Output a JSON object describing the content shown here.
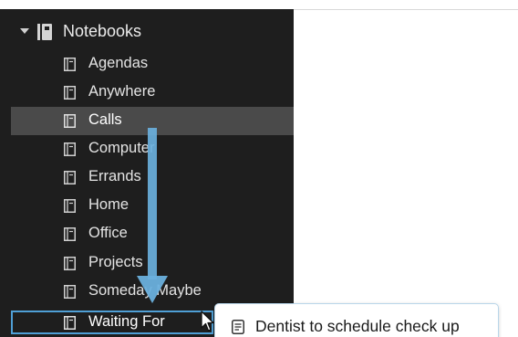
{
  "sidebar": {
    "section": {
      "label": "Notebooks",
      "expanded": true,
      "icon": "notebook-stack-icon"
    },
    "items": [
      {
        "label": "Agendas",
        "icon": "notebook-icon",
        "state": "normal"
      },
      {
        "label": "Anywhere",
        "icon": "notebook-icon",
        "state": "normal"
      },
      {
        "label": "Calls",
        "icon": "notebook-icon",
        "state": "selected"
      },
      {
        "label": "Computer",
        "icon": "notebook-icon",
        "state": "normal"
      },
      {
        "label": "Errands",
        "icon": "notebook-icon",
        "state": "normal"
      },
      {
        "label": "Home",
        "icon": "notebook-icon",
        "state": "normal"
      },
      {
        "label": "Office",
        "icon": "notebook-icon",
        "state": "normal"
      },
      {
        "label": "Projects",
        "icon": "notebook-icon",
        "state": "normal"
      },
      {
        "label": "Someday Maybe",
        "icon": "notebook-icon",
        "state": "normal"
      },
      {
        "label": "Waiting For",
        "icon": "notebook-icon",
        "state": "drop-target"
      }
    ]
  },
  "drag": {
    "note_title": "Dentist to schedule check up",
    "icon": "note-icon"
  },
  "colors": {
    "sidebar_bg": "#1e1e1e",
    "selected_bg": "#4a4a4a",
    "accent": "#4f9fd6",
    "arrow": "#6ab0dd"
  }
}
